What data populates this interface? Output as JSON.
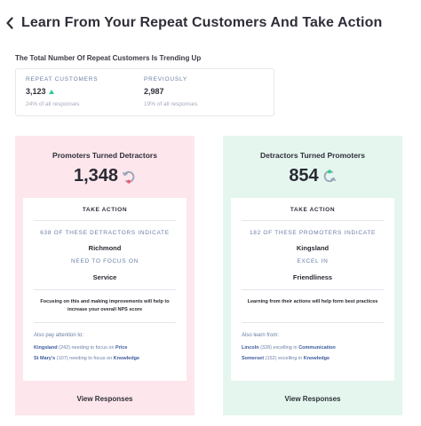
{
  "header": {
    "title": "Learn From Your Repeat Customers And Take Action"
  },
  "subtitle": "The Total Number Of Repeat Customers Is Trending Up",
  "stats": {
    "repeat": {
      "label": "REPEAT CUSTOMERS",
      "value": "3,123",
      "sub": "24% of all responses"
    },
    "previous": {
      "label": "PREVIOUSLY",
      "value": "2,987",
      "sub": "19% of all responses"
    }
  },
  "panels": {
    "left": {
      "title": "Promoters Turned Detractors",
      "count": "1,348",
      "take_action": "TAKE ACTION",
      "indicate": "638 OF THESE DETRACTORS INDICATE",
      "place": "Richmond",
      "focus_label": "NEED TO FOCUS ON",
      "area": "Service",
      "note": "Focusing on this and making improvements will help to increase your overall NPS score",
      "also_label": "Also pay attention to:",
      "items": [
        {
          "name": "Kingsland",
          "text": " (242) needing to focus on ",
          "topic": "Price"
        },
        {
          "name": "St Mary's",
          "text": " (107) needing to focus on ",
          "topic": "Knowledge"
        }
      ],
      "view": "View Responses",
      "icon_color": "#f05a78"
    },
    "right": {
      "title": "Detractors Turned Promoters",
      "count": "854",
      "take_action": "TAKE ACTION",
      "indicate": "182 OF THESE PROMOTERS INDICATE",
      "place": "Kingsland",
      "focus_label": "EXCEL IN",
      "area": "Friendliness",
      "note": "Learning from their actions will help form best practices",
      "also_label": "Also learn from:",
      "items": [
        {
          "name": "Lincoln",
          "text": " (328) excelling in ",
          "topic": "Communication"
        },
        {
          "name": "Somerset",
          "text": " (152) excelling in ",
          "topic": "Knowledge"
        }
      ],
      "view": "View Responses",
      "icon_color": "#2ecc8f"
    }
  },
  "colors": {
    "accent_link": "#3d5a9e",
    "muted": "#6b7fa6",
    "pink_bg": "#fde6ec",
    "green_bg": "#e4f6ee"
  }
}
